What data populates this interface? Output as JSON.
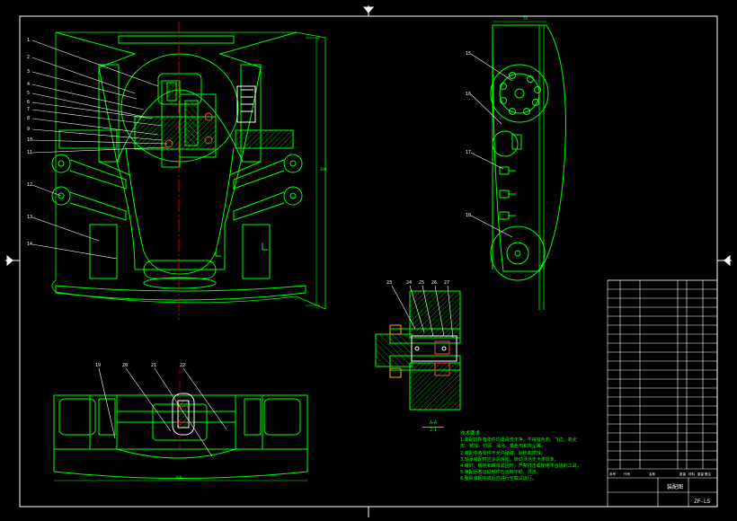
{
  "drawing": {
    "front_view": {
      "callouts": [
        "1",
        "2",
        "3",
        "4",
        "5",
        "6",
        "7",
        "8",
        "9",
        "10",
        "11",
        "12",
        "13",
        "14"
      ],
      "height_dim": "380"
    },
    "side_view": {
      "callouts": [
        "15",
        "16",
        "17",
        "18"
      ],
      "top_dim": "50"
    },
    "plan_view": {
      "callouts": [
        "19",
        "20",
        "21",
        "22"
      ],
      "width_dim": "360"
    },
    "section_view": {
      "callouts": [
        "23",
        "24",
        "25",
        "26",
        "27"
      ],
      "label": "A-A",
      "scale": "2:1"
    },
    "notes": {
      "heading": "技术要求",
      "lines": [
        "1.装配前所有零件均需清洗干净，不得有毛刺、飞边、氧化",
        "皮、锈蚀、切屑、油污、着色剂和灰尘等。",
        "2.装配中各零件不允许磕碰、划伤和锈蚀。",
        "3.轴承装配时应涂润滑脂，转动灵活无卡滞现象。",
        "4.螺钉、螺栓和螺母紧固时，严禁打击或使用不合适的工具。",
        "5.装配后各运动部件应运转平稳、灵活。",
        "6.整机装配完成后应进行空载试运行。"
      ]
    },
    "title_block": {
      "drawing_title": "装配图",
      "drawing_number": "ZF-LS",
      "header_row": [
        "序号",
        "代号",
        "名称",
        "数量",
        "材料",
        "重量",
        "备注"
      ]
    }
  },
  "colors": {
    "background": "#000000",
    "outline": "#00ff00",
    "frame": "#ffffff",
    "centerline": "#ff0000",
    "hidden": "#ff00ff",
    "bearing": "#ff4444",
    "hatch": "#00cc00"
  }
}
